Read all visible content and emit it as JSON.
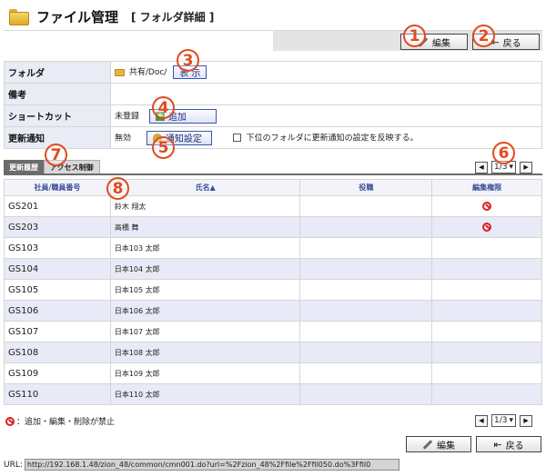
{
  "header": {
    "title": "ファイル管理",
    "subtitle": "[ フォルダ詳細 ]"
  },
  "toolbar": {
    "edit_label": "編集",
    "back_label": "戻る"
  },
  "form": {
    "folder_label": "フォルダ",
    "folder_path": "共有/Doc/",
    "show_button": "表 示",
    "note_label": "備考",
    "note_value": "",
    "shortcut_label": "ショートカット",
    "shortcut_status": "未登録",
    "add_button": "追加",
    "notify_label": "更新通知",
    "notify_status": "無効",
    "notify_button": "通知設定",
    "notify_checkbox_label": "下位のフォルダに更新通知の設定を反映する。"
  },
  "tabs": [
    "更新履歴",
    "アクセス制御"
  ],
  "pager_top": {
    "page": "1/3"
  },
  "pager_bottom": {
    "page": "1/3"
  },
  "table": {
    "headers": [
      "社員/職員番号",
      "氏名▲",
      "役職",
      "編集権限"
    ],
    "rows": [
      {
        "id": "GS201",
        "name": "鈴木 翔太",
        "role": "",
        "prohibited": true
      },
      {
        "id": "GS203",
        "name": "高橋 舞",
        "role": "",
        "prohibited": true
      },
      {
        "id": "GS103",
        "name": "日本103 太郎",
        "role": "",
        "prohibited": false
      },
      {
        "id": "GS104",
        "name": "日本104 太郎",
        "role": "",
        "prohibited": false
      },
      {
        "id": "GS105",
        "name": "日本105 太郎",
        "role": "",
        "prohibited": false
      },
      {
        "id": "GS106",
        "name": "日本106 太郎",
        "role": "",
        "prohibited": false
      },
      {
        "id": "GS107",
        "name": "日本107 太郎",
        "role": "",
        "prohibited": false
      },
      {
        "id": "GS108",
        "name": "日本108 太郎",
        "role": "",
        "prohibited": false
      },
      {
        "id": "GS109",
        "name": "日本109 太郎",
        "role": "",
        "prohibited": false
      },
      {
        "id": "GS110",
        "name": "日本110 太郎",
        "role": "",
        "prohibited": false
      }
    ]
  },
  "legend": {
    "text": "：追加・編集・削除が禁止"
  },
  "url": {
    "label": "URL:",
    "value": "http://192.168.1.48/zion_48/common/cmn001.do?url=%2Fzion_48%2Ffile%2Ffil050.do%3Ffil0"
  },
  "markers": [
    "1",
    "2",
    "3",
    "4",
    "5",
    "6",
    "7",
    "8"
  ],
  "colors": {
    "marker": "#e24a1e",
    "header_bg": "#e9ecf5",
    "alt_row": "#e8eaf7",
    "prohibit": "#e02020"
  }
}
